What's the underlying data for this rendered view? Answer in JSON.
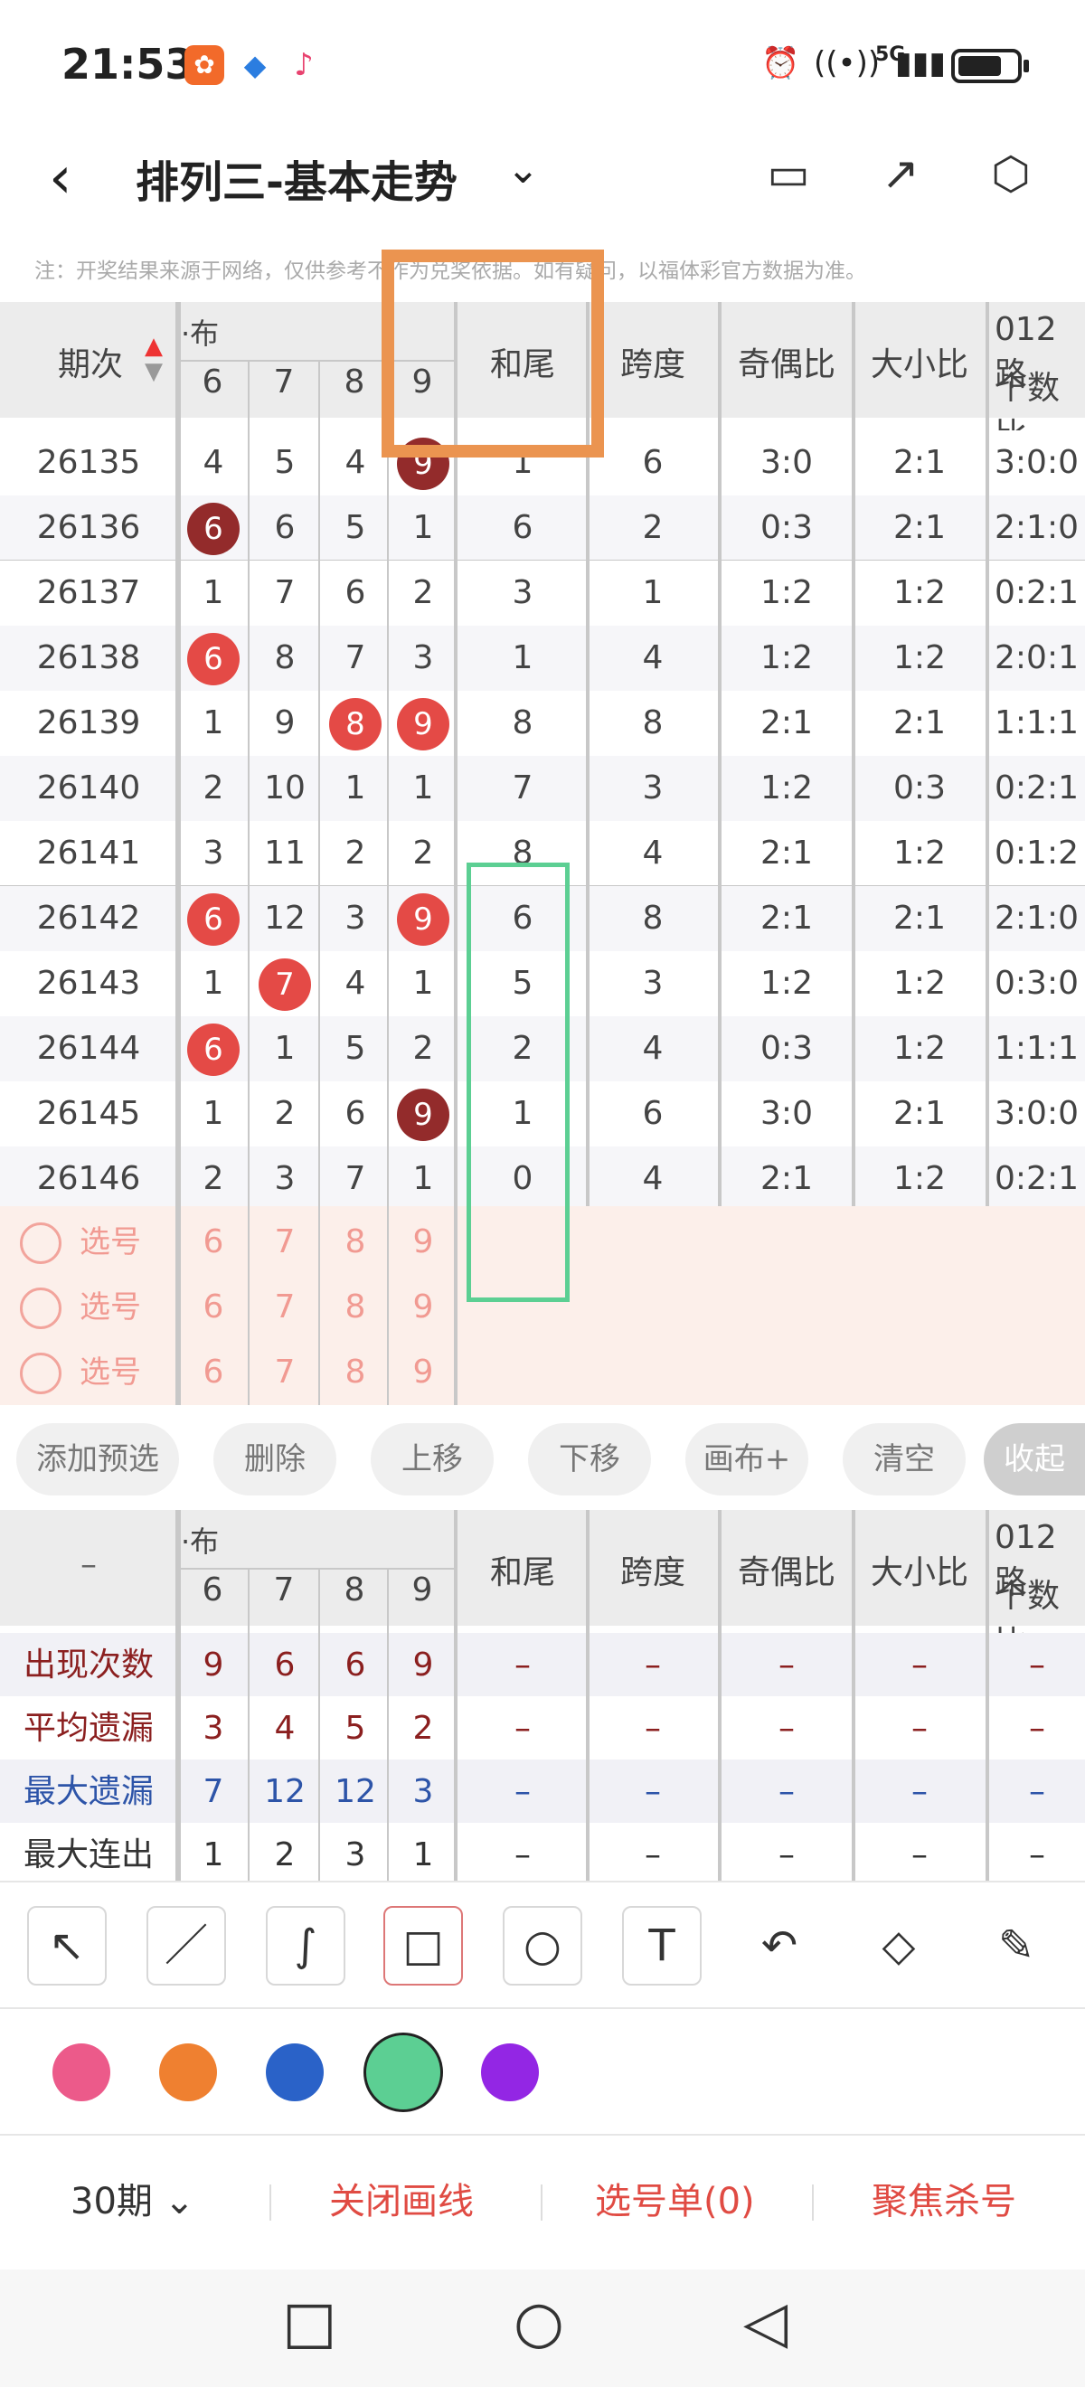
{
  "status": {
    "time": "21:53",
    "network": "5G",
    "battery_level": 0.75
  },
  "titlebar": {
    "title": "排列三-基本走势"
  },
  "notice": "注：开奖结果来源于网络，仅供参考不作为兑奖依据。如有疑问，以福体彩官方数据为准。",
  "table": {
    "headers": {
      "period": "期次",
      "dist_group": "·布",
      "digits": [
        "6",
        "7",
        "8",
        "9"
      ],
      "hewei": "和尾",
      "kuadu": "跨度",
      "jiou": "奇偶比",
      "daxiao": "大小比",
      "r012_l1": "012路",
      "r012_l2": "个数比"
    },
    "rows": [
      {
        "p": "26135",
        "d": [
          "4",
          "5",
          "4",
          "9"
        ],
        "h": "1",
        "k": "6",
        "j": "3:0",
        "dx": "2:1",
        "r": "3:0:0"
      },
      {
        "p": "26136",
        "d": [
          "6",
          "6",
          "5",
          "1"
        ],
        "h": "6",
        "k": "2",
        "j": "0:3",
        "dx": "2:1",
        "r": "2:1:0"
      },
      {
        "p": "26137",
        "d": [
          "1",
          "7",
          "6",
          "2"
        ],
        "h": "3",
        "k": "1",
        "j": "1:2",
        "dx": "1:2",
        "r": "0:2:1"
      },
      {
        "p": "26138",
        "d": [
          "6",
          "8",
          "7",
          "3"
        ],
        "h": "1",
        "k": "4",
        "j": "1:2",
        "dx": "1:2",
        "r": "2:0:1"
      },
      {
        "p": "26139",
        "d": [
          "1",
          "9",
          "8",
          "9"
        ],
        "h": "8",
        "k": "8",
        "j": "2:1",
        "dx": "2:1",
        "r": "1:1:1"
      },
      {
        "p": "26140",
        "d": [
          "2",
          "10",
          "1",
          "1"
        ],
        "h": "7",
        "k": "3",
        "j": "1:2",
        "dx": "0:3",
        "r": "0:2:1"
      },
      {
        "p": "26141",
        "d": [
          "3",
          "11",
          "2",
          "2"
        ],
        "h": "8",
        "k": "4",
        "j": "2:1",
        "dx": "1:2",
        "r": "0:1:2"
      },
      {
        "p": "26142",
        "d": [
          "6",
          "12",
          "3",
          "9"
        ],
        "h": "6",
        "k": "8",
        "j": "2:1",
        "dx": "2:1",
        "r": "2:1:0"
      },
      {
        "p": "26143",
        "d": [
          "1",
          "7",
          "4",
          "1"
        ],
        "h": "5",
        "k": "3",
        "j": "1:2",
        "dx": "1:2",
        "r": "0:3:0"
      },
      {
        "p": "26144",
        "d": [
          "6",
          "1",
          "5",
          "2"
        ],
        "h": "2",
        "k": "4",
        "j": "0:3",
        "dx": "1:2",
        "r": "1:1:1"
      },
      {
        "p": "26145",
        "d": [
          "1",
          "2",
          "6",
          "9"
        ],
        "h": "1",
        "k": "6",
        "j": "3:0",
        "dx": "2:1",
        "r": "3:0:0"
      },
      {
        "p": "26146",
        "d": [
          "2",
          "3",
          "7",
          "1"
        ],
        "h": "0",
        "k": "4",
        "j": "2:1",
        "dx": "1:2",
        "r": "0:2:1"
      }
    ],
    "pick_rows": [
      {
        "label": "选号",
        "d": [
          "6",
          "7",
          "8",
          "9"
        ]
      },
      {
        "label": "选号",
        "d": [
          "6",
          "7",
          "8",
          "9"
        ]
      },
      {
        "label": "选号",
        "d": [
          "6",
          "7",
          "8",
          "9"
        ]
      }
    ]
  },
  "pills": [
    "添加预选",
    "删除",
    "上移",
    "下移",
    "画布+",
    "清空",
    "收起"
  ],
  "stats": {
    "dash": "–",
    "rows": [
      {
        "label": "出现次数",
        "d": [
          "9",
          "6",
          "6",
          "9"
        ],
        "rest": [
          "–",
          "–",
          "–",
          "–",
          "–"
        ]
      },
      {
        "label": "平均遗漏",
        "d": [
          "3",
          "4",
          "5",
          "2"
        ],
        "rest": [
          "–",
          "–",
          "–",
          "–",
          "–"
        ]
      },
      {
        "label": "最大遗漏",
        "d": [
          "7",
          "12",
          "12",
          "3"
        ],
        "rest": [
          "–",
          "–",
          "–",
          "–",
          "–"
        ]
      },
      {
        "label": "最大连出",
        "d": [
          "1",
          "2",
          "3",
          "1"
        ],
        "rest": [
          "–",
          "–",
          "–",
          "–",
          "–"
        ]
      }
    ]
  },
  "colors": {
    "pink": "#ec5a8a",
    "orange": "#ef8030",
    "blue": "#2a62c8",
    "green": "#5ccf93",
    "purple": "#9326e4"
  },
  "bottombar": {
    "period_select": "30期",
    "close_draw": "关闭画线",
    "pick_list": "选号单(0)",
    "focus_kill": "聚焦杀号"
  }
}
